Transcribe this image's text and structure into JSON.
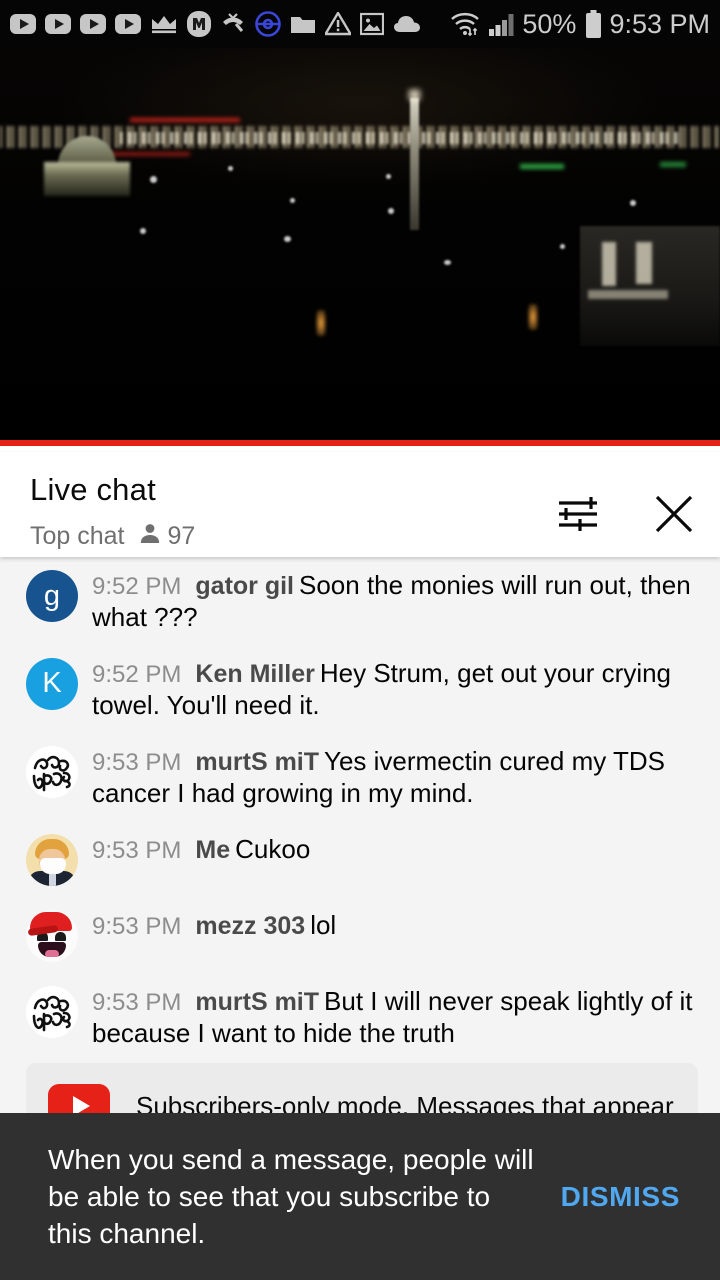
{
  "status_bar": {
    "icons": [
      "youtube-play-icon",
      "youtube-play-icon",
      "youtube-play-icon",
      "youtube-play-icon",
      "crown-icon",
      "monster-m-icon",
      "missed-call-icon",
      "pokeball-icon",
      "folder-icon",
      "warning-triangle-icon",
      "image-icon",
      "cloud-icon"
    ],
    "wifi": "wifi-icon",
    "signal": "cell-signal-icon",
    "battery_percent": "50%",
    "battery": "battery-icon",
    "time": "9:53 PM"
  },
  "video": {
    "description": "night cityscape live stream",
    "progress_color": "#e62117"
  },
  "chat_header": {
    "title": "Live chat",
    "subtitle": "Top chat",
    "viewer_count": "97",
    "person_icon": "person-icon",
    "settings_icon": "tune-icon",
    "close_icon": "close-icon"
  },
  "messages": [
    {
      "time": "9:52 PM",
      "author": "gator gil",
      "text": "Soon the monies will run out, then what ???",
      "avatar_type": "initial",
      "avatar_initial": "g",
      "avatar_color": "#17548f"
    },
    {
      "time": "9:52 PM",
      "author": "Ken Miller",
      "text": "Hey Strum, get out your crying towel. You'll need it.",
      "avatar_type": "initial",
      "avatar_initial": "K",
      "avatar_color": "#19a0e0"
    },
    {
      "time": "9:53 PM",
      "author": "murtS miT",
      "text": "Yes ivermectin cured my TDS cancer I had growing in my mind.",
      "avatar_type": "graffiti",
      "avatar_initial": "",
      "avatar_color": "#ffffff"
    },
    {
      "time": "9:53 PM",
      "author": "Me",
      "text": "Cukoo",
      "avatar_type": "photo",
      "avatar_initial": "",
      "avatar_color": "#f2dfab"
    },
    {
      "time": "9:53 PM",
      "author": "mezz 303",
      "text": "lol",
      "avatar_type": "awesome",
      "avatar_initial": "",
      "avatar_color": "#fbfbfb"
    },
    {
      "time": "9:53 PM",
      "author": "murtS miT",
      "text": "But I will never speak lightly of it because I want to hide the truth",
      "avatar_type": "graffiti",
      "avatar_initial": "",
      "avatar_color": "#ffffff"
    }
  ],
  "subscribers_banner": {
    "icon": "youtube-play-icon",
    "text": "Subscribers-only mode. Messages that appear"
  },
  "snackbar": {
    "text": "When you send a message, people will be able to see that you subscribe to this channel.",
    "action_label": "DISMISS",
    "action_color": "#50a8f0"
  }
}
